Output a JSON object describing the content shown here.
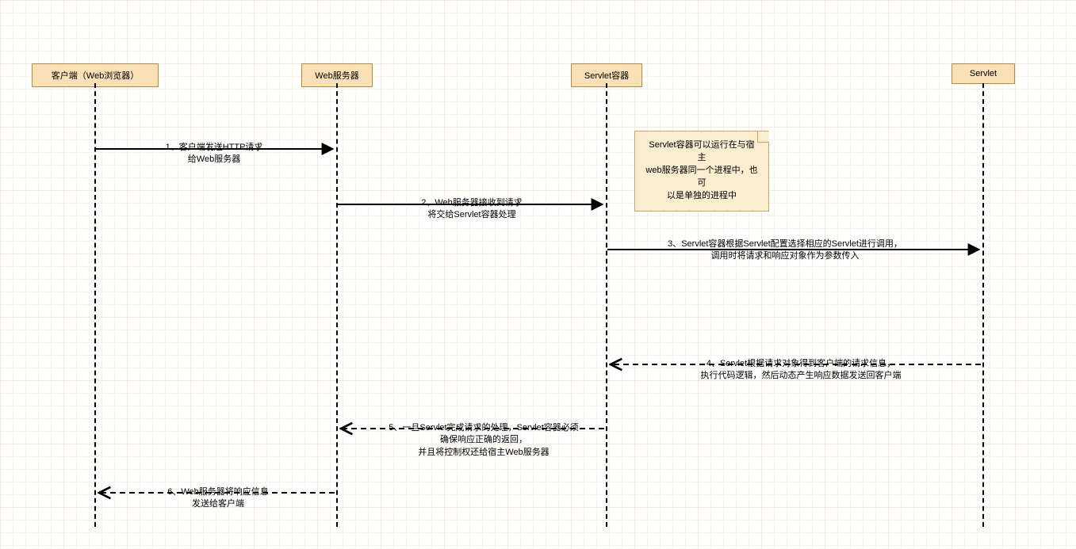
{
  "participants": {
    "client": "客户端（Web浏览器）",
    "webserver": "Web服务器",
    "container": "Servlet容器",
    "servlet": "Servlet"
  },
  "note": {
    "text": "Servlet容器可以运行在与宿主\nweb服务器同一个进程中，也可\n以是单独的进程中"
  },
  "messages": {
    "m1": "1、客户端发送HTTP请求\n给Web服务器",
    "m2": "2、Web服务器接收到请求\n将交给Servlet容器处理",
    "m3": "3、Servlet容器根据Servlet配置选择相应的Servlet进行调用，\n调用时将请求和响应对象作为参数传入",
    "m4": "4、Servlet根据请求对象得到客户端的请求信息，\n执行代码逻辑，然后动态产生响应数据发送回客户端",
    "m5": "5、一旦Servlet完成请求的处理，Servlet容器必须\n确保响应正确的返回，\n并且将控制权还给宿主Web服务器",
    "m6": "6、Web服务器将响应信息\n发送给客户端"
  }
}
